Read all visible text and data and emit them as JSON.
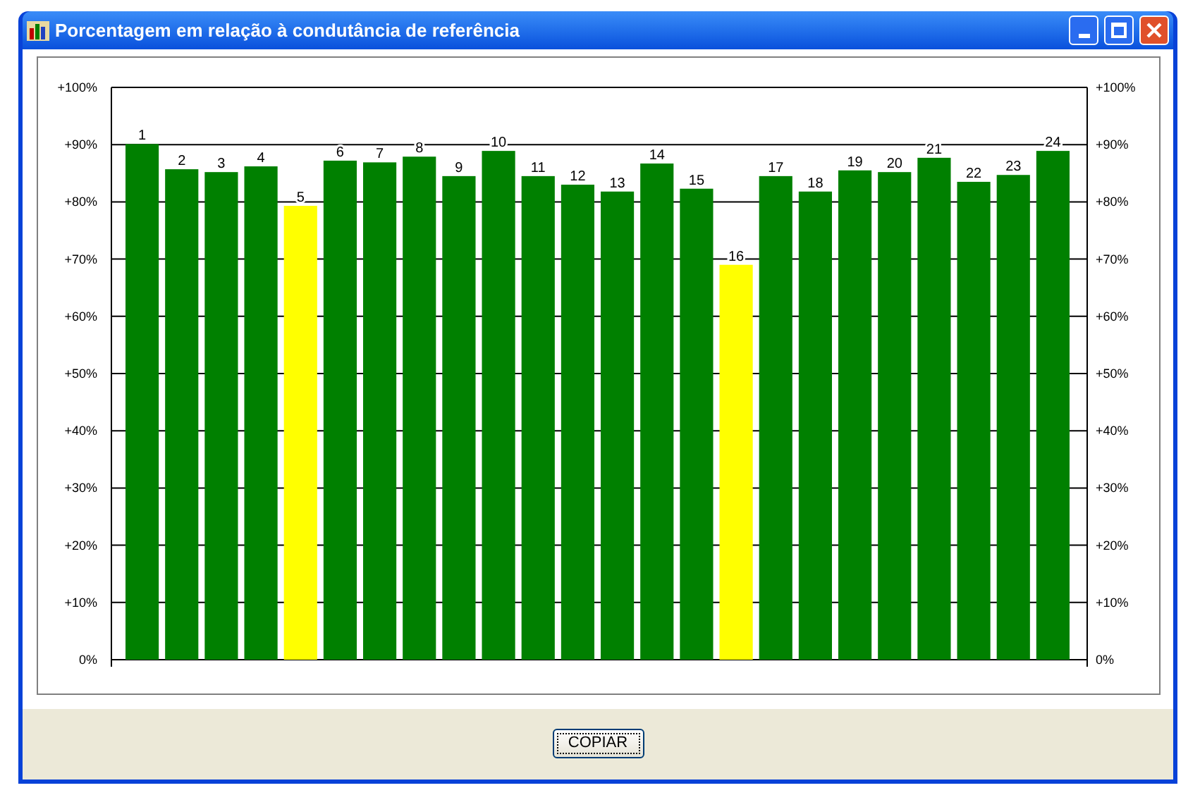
{
  "window": {
    "title": "Porcentagem em relação à condutância de referência"
  },
  "chart": {
    "chart_data": {
      "type": "bar",
      "categories": [
        "1",
        "2",
        "3",
        "4",
        "5",
        "6",
        "7",
        "8",
        "9",
        "10",
        "11",
        "12",
        "13",
        "14",
        "15",
        "16",
        "17",
        "18",
        "19",
        "20",
        "21",
        "22",
        "23",
        "24"
      ],
      "series": [
        {
          "color": "#008000",
          "values": [
            90.1,
            85.7,
            85.2,
            86.2,
            null,
            87.2,
            86.9,
            87.9,
            84.5,
            88.9,
            84.5,
            83.0,
            81.8,
            86.7,
            82.3,
            null,
            84.5,
            81.8,
            85.5,
            85.2,
            87.7,
            83.5,
            84.7,
            88.9
          ]
        },
        {
          "color": "#ffff00",
          "values": [
            null,
            null,
            null,
            null,
            79.3,
            null,
            null,
            null,
            null,
            null,
            null,
            null,
            null,
            null,
            null,
            69.0,
            null,
            null,
            null,
            null,
            null,
            null,
            null,
            null
          ]
        }
      ],
      "stacked": true,
      "grid": true,
      "ylim": [
        0,
        100
      ],
      "yticks": [
        {
          "value": 0,
          "label": "0%"
        },
        {
          "value": 10,
          "label": "+10%"
        },
        {
          "value": 20,
          "label": "+20%"
        },
        {
          "value": 30,
          "label": "+30%"
        },
        {
          "value": 40,
          "label": "+40%"
        },
        {
          "value": 50,
          "label": "+50%"
        },
        {
          "value": 60,
          "label": "+60%"
        },
        {
          "value": 70,
          "label": "+70%"
        },
        {
          "value": 80,
          "label": "+80%"
        },
        {
          "value": 90,
          "label": "+90%"
        },
        {
          "value": 100,
          "label": "+100%"
        }
      ]
    }
  },
  "buttons": [
    "COPIAR"
  ]
}
